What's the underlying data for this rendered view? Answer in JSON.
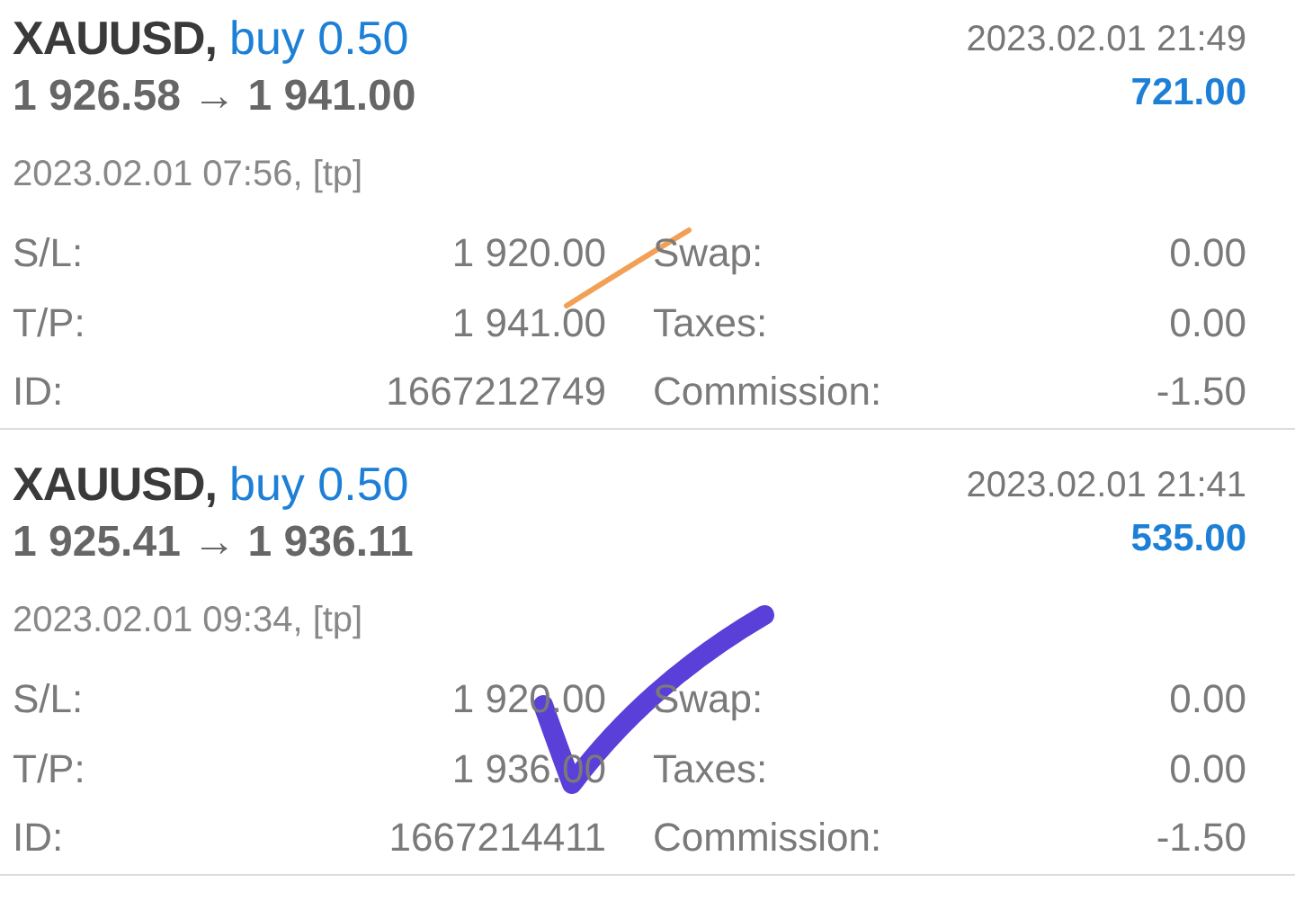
{
  "trades": [
    {
      "symbol": "XAUUSD,",
      "side": "buy 0.50",
      "close_time": "2023.02.01 21:49",
      "prices": "1 926.58 → 1 941.00",
      "profit": "721.00",
      "open_time": "2023.02.01 07:56, [tp]",
      "details": [
        {
          "label": "S/L:",
          "value": "1 920.00",
          "label2": "Swap:",
          "value2": "0.00"
        },
        {
          "label": "T/P:",
          "value": "1 941.00",
          "label2": "Taxes:",
          "value2": "0.00"
        },
        {
          "label": "ID:",
          "value": "1667212749",
          "label2": "Commission:",
          "value2": "-1.50"
        }
      ]
    },
    {
      "symbol": "XAUUSD,",
      "side": "buy 0.50",
      "close_time": "2023.02.01 21:41",
      "prices": "1 925.41 → 1 936.11",
      "profit": "535.00",
      "open_time": "2023.02.01 09:34, [tp]",
      "details": [
        {
          "label": "S/L:",
          "value": "1 920.00",
          "label2": "Swap:",
          "value2": "0.00"
        },
        {
          "label": "T/P:",
          "value": "1 936.00",
          "label2": "Taxes:",
          "value2": "0.00"
        },
        {
          "label": "ID:",
          "value": "1667214411",
          "label2": "Commission:",
          "value2": "-1.50"
        }
      ]
    }
  ]
}
